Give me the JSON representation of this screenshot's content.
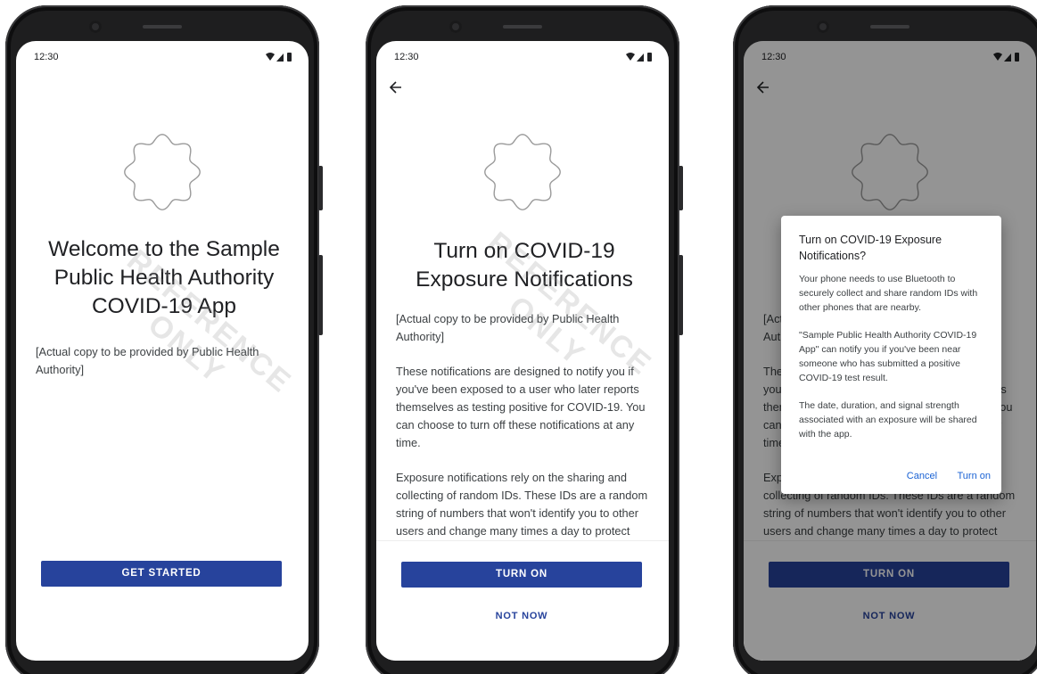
{
  "status": {
    "time": "12:30"
  },
  "watermark": {
    "line1": "REFERENCE",
    "line2": "ONLY"
  },
  "screen1": {
    "headline": "Welcome to the Sample Public Health Authority COVID-19 App",
    "body": "[Actual copy to be provided by Public Health Authority]",
    "primary_button": "GET STARTED"
  },
  "screen2": {
    "headline": "Turn on COVID-19 Exposure Notifications",
    "paragraphs": [
      "[Actual copy to be provided by Public Health Authority]",
      "These notifications are designed to notify you if you've been exposed to a user who later reports themselves as testing positive for COVID-19. You can choose to turn off these notifications at any time.",
      "Exposure notifications rely on the sharing and collecting of random IDs. These IDs are a random string of numbers that won't identify you to other users and change many times a day to protect your privacy."
    ],
    "primary_button": "TURN ON",
    "secondary_button": "NOT NOW"
  },
  "dialog": {
    "title": "Turn on COVID-19 Exposure Notifications?",
    "paragraphs": [
      "Your phone needs to use Bluetooth to securely collect and share random IDs with other phones that are nearby.",
      "\"Sample Public Health Authority COVID-19 App\" can notify you if you've been near someone who has submitted a positive COVID-19 test result.",
      "The date, duration, and signal strength associated with an exposure will be shared with the app."
    ],
    "cancel": "Cancel",
    "confirm": "Turn on"
  },
  "colors": {
    "primary": "#27439c",
    "dialog_action": "#1a62d4",
    "scrim": "rgba(0,0,0,0.42)"
  },
  "icons": [
    "wifi-icon",
    "cell-signal-icon",
    "battery-icon",
    "back-arrow-icon",
    "badge-icon"
  ]
}
